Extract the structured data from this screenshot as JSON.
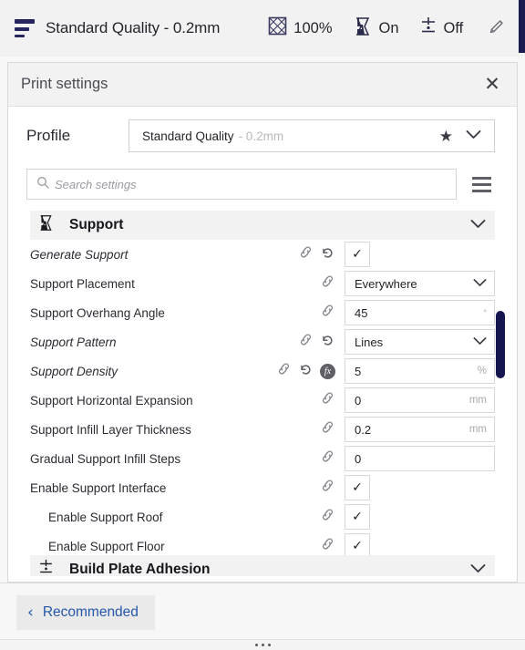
{
  "toolbar": {
    "profile_icon": "layers-icon",
    "profile_label": "Standard Quality - 0.2mm",
    "items": [
      {
        "icon": "infill-icon",
        "value": "100%"
      },
      {
        "icon": "support-icon",
        "value": "On"
      },
      {
        "icon": "adhesion-icon",
        "value": "Off"
      }
    ],
    "edit_icon": "pencil-icon"
  },
  "panel": {
    "title": "Print settings",
    "close_label": "✕"
  },
  "profile": {
    "label": "Profile",
    "name": "Standard Quality",
    "sub": "- 0.2mm",
    "star_glyph": "★",
    "chevron_icon": "chevron-down-icon"
  },
  "search": {
    "placeholder": "Search settings",
    "value": "",
    "icon": "search-icon",
    "menu_icon": "hamburger-menu-icon"
  },
  "category": {
    "icon": "support-icon",
    "title": "Support",
    "chevron_icon": "chevron-down-icon"
  },
  "next_category": {
    "icon": "adhesion-icon",
    "title": "Build Plate Adhesion",
    "chevron_icon": "chevron-down-icon"
  },
  "settings": [
    {
      "label": "Generate Support",
      "italic": true,
      "indent": false,
      "icons": [
        "link-icon",
        "revert-icon"
      ],
      "control": "checkbox",
      "value": "✓",
      "unit": ""
    },
    {
      "label": "Support Placement",
      "italic": false,
      "indent": false,
      "icons": [
        "link-icon"
      ],
      "control": "dropdown",
      "value": "Everywhere",
      "unit": ""
    },
    {
      "label": "Support Overhang Angle",
      "italic": false,
      "indent": false,
      "icons": [
        "link-icon"
      ],
      "control": "input",
      "value": "45",
      "unit": "°"
    },
    {
      "label": "Support Pattern",
      "italic": true,
      "indent": false,
      "icons": [
        "link-icon",
        "revert-icon"
      ],
      "control": "dropdown",
      "value": "Lines",
      "unit": ""
    },
    {
      "label": "Support Density",
      "italic": true,
      "indent": false,
      "icons": [
        "link-icon",
        "revert-icon",
        "fx-icon"
      ],
      "control": "input",
      "value": "5",
      "unit": "%"
    },
    {
      "label": "Support Horizontal Expansion",
      "italic": false,
      "indent": false,
      "icons": [
        "link-icon"
      ],
      "control": "input",
      "value": "0",
      "unit": "mm"
    },
    {
      "label": "Support Infill Layer Thickness",
      "italic": false,
      "indent": false,
      "icons": [
        "link-icon"
      ],
      "control": "input",
      "value": "0.2",
      "unit": "mm"
    },
    {
      "label": "Gradual Support Infill Steps",
      "italic": false,
      "indent": false,
      "icons": [
        "link-icon"
      ],
      "control": "input",
      "value": "0",
      "unit": ""
    },
    {
      "label": "Enable Support Interface",
      "italic": false,
      "indent": false,
      "icons": [
        "link-icon"
      ],
      "control": "checkbox",
      "value": "✓",
      "unit": ""
    },
    {
      "label": "Enable Support Roof",
      "italic": false,
      "indent": true,
      "icons": [
        "link-icon"
      ],
      "control": "checkbox",
      "value": "✓",
      "unit": ""
    },
    {
      "label": "Enable Support Floor",
      "italic": false,
      "indent": true,
      "icons": [
        "link-icon"
      ],
      "control": "checkbox",
      "value": "✓",
      "unit": ""
    }
  ],
  "footer": {
    "recommended_label": "Recommended",
    "back_chevron": "‹",
    "grip_icon": "drag-handle-icon"
  },
  "colors": {
    "accent_navy": "#151550",
    "link_blue": "#2556a8",
    "panel_bg": "#ffffff",
    "header_bg": "#f2f2f2"
  }
}
